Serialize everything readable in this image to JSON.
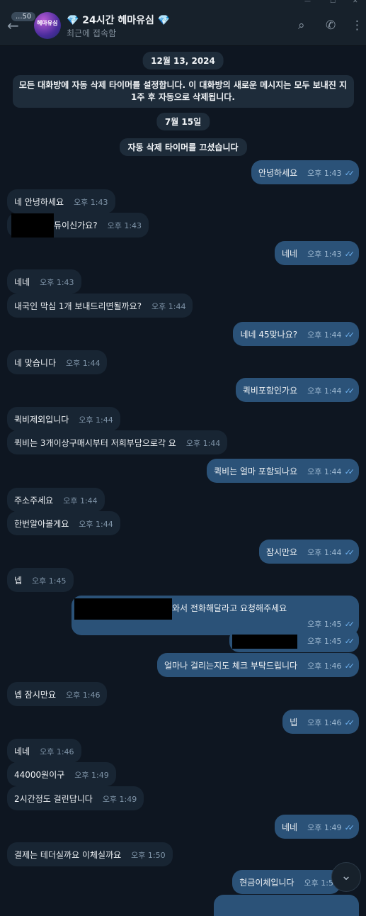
{
  "header": {
    "title": "💎 24시간 헤마유심 💎",
    "status": "최근에 접속함",
    "unread_count": "...50",
    "avatar_text": "헤마유심"
  },
  "system": {
    "date1": "12월 13, 2024",
    "timer_set": "모든 대화방에 자동 삭제 타이머를 설정합니다. 이 대화방의 새로운 메시지는 모두 보내진 지 1주 후 자동으로 삭제됩니다.",
    "date2": "7월 15일",
    "timer_off": "자동 삭제 타이머를 끄셨습니다"
  },
  "messages": [
    {
      "text": "안녕하세요",
      "time": "오후 1:43"
    },
    {
      "text": "네 안녕하세요",
      "time": "오후 1:43"
    },
    {
      "text": "듀이신가요?",
      "time": "오후 1:43"
    },
    {
      "text": "네네",
      "time": "오후 1:43"
    },
    {
      "text": "네네",
      "time": "오후 1:43"
    },
    {
      "text": "내국인 막심 1개 보내드리면될까요?",
      "time": "오후 1:44"
    },
    {
      "text": "네네 45맞나요?",
      "time": "오후 1:44"
    },
    {
      "text": "네 맞습니다",
      "time": "오후 1:44"
    },
    {
      "text": "퀵비포함인가요",
      "time": "오후 1:44"
    },
    {
      "text": "퀵비제외입니다",
      "time": "오후 1:44"
    },
    {
      "text": "퀵비는 3개이상구매시부터 저희부담으로각 요",
      "time": "오후 1:44"
    },
    {
      "text": "퀵비는 얼마 포함되나요",
      "time": "오후 1:44"
    },
    {
      "text": "주소주세요",
      "time": "오후 1:44"
    },
    {
      "text": "한번알아볼게요",
      "time": "오후 1:44"
    },
    {
      "text": "잠시만요",
      "time": "오후 1:44"
    },
    {
      "text": "넵",
      "time": "오후 1:45"
    },
    {
      "text": "와서 전화해달라고 요청해주세요",
      "time": "오후 1:45"
    },
    {
      "text": "",
      "time": "오후 1:45"
    },
    {
      "text": "얼마나 걸리는지도 체크 부탁드립니다",
      "time": "오후 1:46"
    },
    {
      "text": "넵 잠시만요",
      "time": "오후 1:46"
    },
    {
      "text": "넵",
      "time": "오후 1:46"
    },
    {
      "text": "네네",
      "time": "오후 1:46"
    },
    {
      "text": "44000원이구",
      "time": "오후 1:49"
    },
    {
      "text": "2시간정도 걸린답니다",
      "time": "오후 1:49"
    },
    {
      "text": "네네",
      "time": "오후 1:49"
    },
    {
      "text": "결제는 테더실까요 이체실까요",
      "time": "오후 1:50"
    },
    {
      "text": "현금이체입니다",
      "time": "오후 1:5"
    }
  ],
  "colors": {
    "background": "#0e1621",
    "incoming_bubble": "#182533",
    "outgoing_bubble": "#2b5278",
    "read_ticks": "#6fb3f2"
  }
}
